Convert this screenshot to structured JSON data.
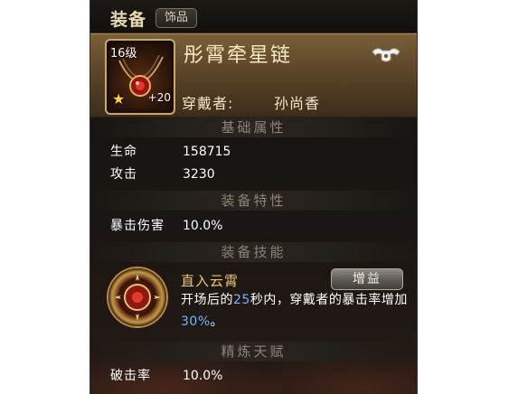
{
  "header": {
    "title": "装备",
    "tag": "饰品"
  },
  "item": {
    "level": "16级",
    "plus": "+20",
    "name": "彤霄牵星链",
    "wearer_label": "穿戴者:",
    "wearer_value": "孙尚香",
    "icons": {
      "lock": "lock-icon",
      "star": "star-icon",
      "necklace": "necklace-icon"
    }
  },
  "sections": {
    "base_attributes": "基础属性",
    "equipment_traits": "装备特性",
    "equipment_skill": "装备技能",
    "refine_talent": "精炼天赋"
  },
  "base_attributes": [
    {
      "key": "生命",
      "value": "158715"
    },
    {
      "key": "攻击",
      "value": "3230"
    }
  ],
  "traits": [
    {
      "key": "暴击伤害",
      "value": "10.0%"
    }
  ],
  "skill": {
    "name": "直入云霄",
    "badge": "增益",
    "desc_part1": "开场后的",
    "desc_seconds": "25",
    "desc_part2": "秒内，穿戴者的暴击率增加",
    "desc_percent": "30%",
    "desc_part3": "。"
  },
  "talent": [
    {
      "key": "破击率",
      "value": "10.0%"
    }
  ],
  "colors": {
    "highlight": "#6fb6ff",
    "gold_text": "#f0c766",
    "section_text": "#8c8474"
  }
}
